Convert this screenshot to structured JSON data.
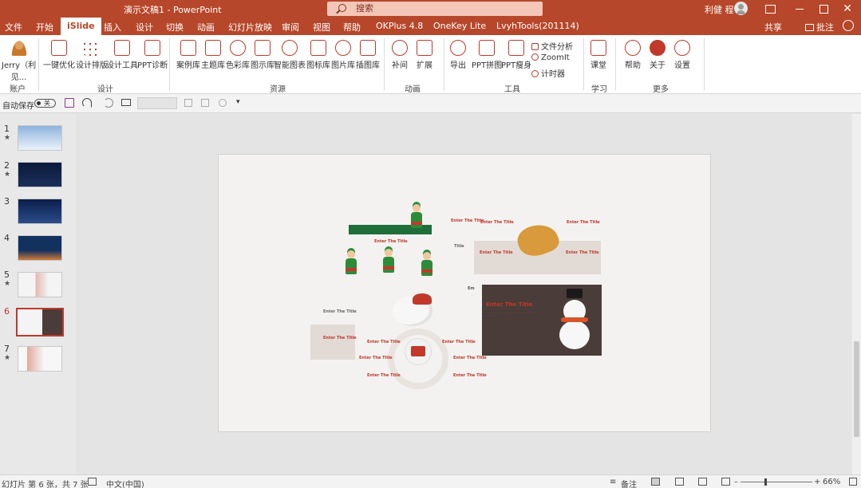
{
  "window": {
    "title": "演示文稿1  -  PowerPoint",
    "search_placeholder": "搜索",
    "user_name": "利健 程"
  },
  "tabs": [
    {
      "label": "文件"
    },
    {
      "label": "开始"
    },
    {
      "label": "iSlide",
      "active": true
    },
    {
      "label": "插入"
    },
    {
      "label": "设计"
    },
    {
      "label": "切换"
    },
    {
      "label": "动画"
    },
    {
      "label": "幻灯片放映"
    },
    {
      "label": "审阅"
    },
    {
      "label": "视图"
    },
    {
      "label": "帮助"
    },
    {
      "label": "OKPlus 4.8"
    },
    {
      "label": "OneKey Lite"
    },
    {
      "label": "LvyhTools(201114)"
    }
  ],
  "tab_actions": {
    "share": "共享",
    "comment": "批注"
  },
  "ribbon": {
    "account": {
      "user": "Jerry（利",
      "user2": "见...",
      "group": "账户"
    },
    "design": {
      "group": "设计",
      "buttons": [
        "一键优化",
        "设计排版",
        "设计工具",
        "PPT诊断"
      ]
    },
    "resources": {
      "group": "资源",
      "buttons": [
        "案例库",
        "主题库",
        "色彩库",
        "图示库",
        "智能图表",
        "图标库",
        "图片库",
        "插图库"
      ]
    },
    "animation": {
      "group": "动画",
      "buttons": [
        "补间",
        "扩展"
      ]
    },
    "tools": {
      "group": "工具",
      "buttons": [
        "导出",
        "PPT拼图",
        "PPT瘦身"
      ],
      "small": [
        "文件分析",
        "ZoomIt",
        "计时器"
      ]
    },
    "learn": {
      "group": "学习",
      "buttons": [
        "课堂"
      ]
    },
    "more": {
      "group": "更多",
      "buttons": [
        "帮助",
        "关于",
        "设置"
      ]
    }
  },
  "qat": {
    "autosave": "自动保存",
    "toggle": "关"
  },
  "thumbnails": [
    {
      "num": "1",
      "star": "★",
      "colors": [
        "#8fb4dc",
        "#eaf2fb"
      ]
    },
    {
      "num": "2",
      "star": "★",
      "colors": [
        "#0a1a3a",
        "#1a2f5a"
      ]
    },
    {
      "num": "3",
      "star": "",
      "colors": [
        "#0b1f4a",
        "#2a4c8a"
      ]
    },
    {
      "num": "4",
      "star": "",
      "colors": [
        "#12315e",
        "#d07a3a"
      ]
    },
    {
      "num": "5",
      "star": "★",
      "colors": [
        "#f4f4f4",
        "#c0392b"
      ]
    },
    {
      "num": "6",
      "star": "",
      "colors": [
        "#f4f4f4",
        "#4a3c38"
      ],
      "selected": true
    },
    {
      "num": "7",
      "star": "★",
      "colors": [
        "#f7f7f7",
        "#c0392b"
      ]
    }
  ],
  "slide": {
    "headings": [
      "Enter The Title",
      "Enter The Title",
      "Enter The Title",
      "Enter The Title",
      "Enter The Title",
      "Enter The Title",
      "Enter The Title",
      "Enter The Title",
      "Enter The Title",
      "Enter The Title",
      "Enter The Title",
      "Enter The Title",
      "Enter The Title",
      "Enter The Title"
    ],
    "big_heading": "Enter The Title",
    "title_word": "Title",
    "partial": "Em"
  },
  "status": {
    "slide_info": "幻灯片 第 6 张，共 7 张",
    "language": "中文(中国)",
    "notes": "备注",
    "zoom": "66%"
  }
}
